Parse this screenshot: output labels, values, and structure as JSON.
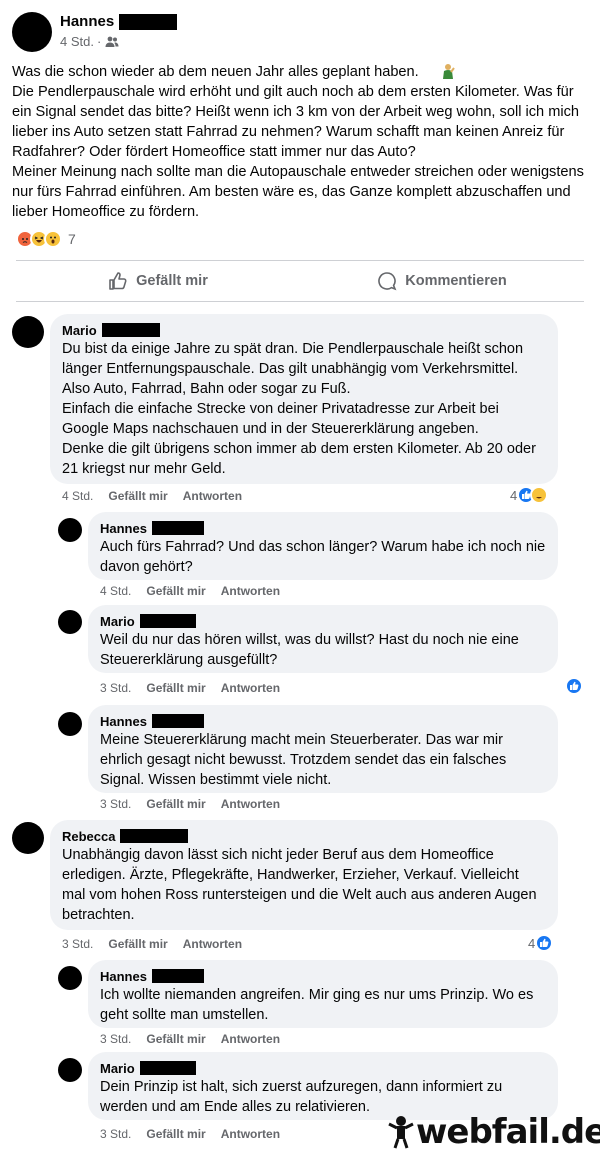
{
  "post": {
    "author": "Hannes",
    "time": "4 Std.",
    "text": "Was die schon wieder ab dem neuen Jahr alles geplant haben. \nDie Pendlerpauschale wird erhöht und gilt auch noch ab dem ersten Kilometer. Was für ein Signal sendet das bitte? Heißt wenn ich 3 km von der Arbeit weg wohn, soll ich mich lieber ins Auto setzen statt Fahrrad zu nehmen? Warum schafft man keinen Anreiz für Radfahrer? Oder fördert Homeoffice statt immer nur das Auto?\nMeiner Meinung nach sollte man die Autopauschale entweder streichen oder wenigstens nur fürs Fahrrad einführen. Am besten wäre es, das Ganze komplett abzuschaffen und lieber Homeoffice zu fördern.",
    "reaction_count": "7",
    "reaction_icons": [
      "angry-emoji",
      "haha-emoji",
      "wow-emoji"
    ]
  },
  "actions": {
    "like": "Gefällt mir",
    "comment": "Kommentieren"
  },
  "comment_actions": {
    "like": "Gefällt mir",
    "reply": "Antworten"
  },
  "comments": [
    {
      "author": "Mario",
      "text": "Du bist da einige Jahre zu spät dran. Die Pendlerpauschale heißt schon länger Entfernungspauschale. Das gilt unabhängig vom Verkehrsmittel. Also Auto, Fahrrad, Bahn oder sogar zu Fuß.\nEinfach die einfache Strecke von deiner Privatadresse zur Arbeit bei Google Maps nachschauen und in der Steuererklärung angeben.\nDenke die gilt übrigens schon immer ab dem ersten Kilometer. Ab 20 oder 21 kriegst nur mehr Geld.",
      "time": "4 Std.",
      "reactions": "4"
    },
    {
      "author": "Hannes",
      "text": "Auch fürs Fahrrad? Und das schon länger? Warum habe ich noch nie davon gehört?",
      "time": "4 Std."
    },
    {
      "author": "Mario",
      "text": "Weil du nur das hören willst, was du willst? Hast du noch nie eine Steuererklärung ausgefüllt?",
      "time": "3 Std."
    },
    {
      "author": "Hannes",
      "text": "Meine Steuererklärung macht mein Steuerberater. Das war mir ehrlich gesagt nicht bewusst. Trotzdem sendet das ein falsches Signal. Wissen bestimmt viele nicht.",
      "time": "3 Std."
    },
    {
      "author": "Rebecca",
      "text": "Unabhängig davon lässt sich nicht jeder Beruf aus dem Homeoffice erledigen. Ärzte, Pflegekräfte, Handwerker, Erzieher, Verkauf. Vielleicht mal vom hohen Ross runtersteigen und die Welt auch aus anderen Augen betrachten.",
      "time": "3 Std.",
      "reactions": "4"
    },
    {
      "author": "Hannes",
      "text": "Ich wollte niemanden angreifen. Mir ging es nur ums Prinzip. Wo es geht sollte man umstellen.",
      "time": "3 Std."
    },
    {
      "author": "Mario",
      "text": "Dein Prinzip ist halt, sich zuerst aufzuregen, dann informiert zu werden und am Ende alles zu relativieren.",
      "time": "3 Std."
    }
  ],
  "watermark": "webfail.de",
  "colors": {
    "like_blue": "#1877f2",
    "bubble_bg": "#f0f2f5",
    "meta_gray": "#65676b"
  }
}
